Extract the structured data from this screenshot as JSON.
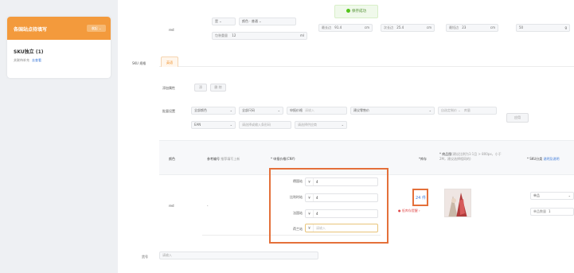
{
  "site_card": {
    "title": "各国站点待填写",
    "pill": "收起 ⌄",
    "sku_name": "SKU独立 (1)",
    "sku_sub": "关联待补充",
    "sku_link": "去查看"
  },
  "toast": {
    "text": "保存成功"
  },
  "top_row": {
    "color_value": "red",
    "sel1": "是",
    "sel2": "颜色 · 普通",
    "weight_label": "包装重量",
    "weight_value": "12",
    "weight_unit": "ml",
    "length_label": "最长边",
    "length_value": "91.4",
    "length_unit": "cm",
    "second_label": "次长边",
    "second_value": "25.4",
    "second_unit": "cm",
    "shortest_label": "最短边",
    "shortest_value": "23",
    "shortest_unit": "cm",
    "extra_value": "50",
    "extra_unit": "g"
  },
  "sku_section": {
    "label": "SKU 规格",
    "tab": "英语",
    "batch_label": "添加属性",
    "btn_add": "添",
    "btn_del": "删 除",
    "bulk_label": "批量设置",
    "filter_all_color": "全部颜色",
    "filter_all_size": "全部尺码",
    "field_price": "申报价格",
    "field_price_ph": "请输入",
    "field_stock_label": "建议零售价",
    "field_stock_ph": "",
    "field_right_ph": "自选定制价 ⌄",
    "field_right_ph2": "库量",
    "ean_label": "EAN",
    "ean_ph": "请选择或输入条形码",
    "ean_ph2": "请选择供应商",
    "apply_btn": "应用"
  },
  "table": {
    "headers": {
      "color": "颜色",
      "code": "参考编号",
      "code_note": "推荐填写上新",
      "price": "* 申报价格(CNY)",
      "stock": "*库存",
      "image": "* 商品图",
      "image_note": "(建议比例为1:1且 > 800px，小于2M，建议选择相同的)",
      "sku_cat": "* SKU分类",
      "sku_cat_link": "说明及说明"
    },
    "row": {
      "color": "red",
      "code": "-",
      "prices": [
        {
          "label": "德国站",
          "currency": "¥",
          "value": "4"
        },
        {
          "label": "比利时站",
          "currency": "¥",
          "value": "4"
        },
        {
          "label": "法国站",
          "currency": "¥",
          "value": "4"
        },
        {
          "label": "荷兰站",
          "currency": "¥",
          "value": "请输入"
        }
      ],
      "stock_value": "24",
      "stock_unit": "件",
      "stock_warning": "● 低库存提醒 ›",
      "sku_cat_value": "单品",
      "sku_qty_label": "单品数量",
      "sku_qty_value": "1"
    }
  },
  "footer": {
    "label": "货号",
    "placeholder": "请输入"
  }
}
